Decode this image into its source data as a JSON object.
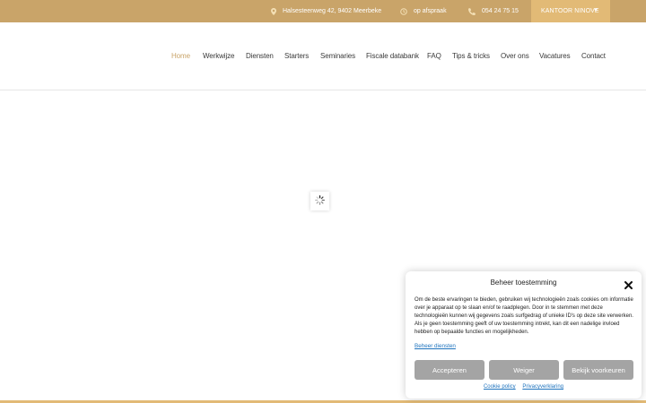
{
  "topbar": {
    "address": "Halsesteenweg 42, 9402 Meerbeke",
    "appointment": "op afspraak",
    "phone": "054 24 75 15",
    "office_selector": "KANTOOR NINOVE"
  },
  "nav": {
    "items": [
      "Home",
      "Werkwijze",
      "Diensten",
      "Starters",
      "Seminaries",
      "Fiscale databank",
      "FAQ",
      "Tips & tricks",
      "Over ons",
      "Vacatures",
      "Contact"
    ],
    "active": "Home"
  },
  "cookie": {
    "title": "Beheer toestemming",
    "body": "Om de beste ervaringen te bieden, gebruiken wij technologieën zoals cookies om informatie over je apparaat op te slaan en/of te raadplegen. Door in te stemmen met deze technologieën kunnen wij gegevens zoals surfgedrag of unieke ID's op deze site verwerken. Als je geen toestemming geeft of uw toestemming intrekt, kan dit een nadelige invloed hebben op bepaalde functies en mogelijkheden.",
    "manage_link": "Beheer diensten",
    "accept": "Accepteren",
    "deny": "Weiger",
    "preferences": "Bekijk voorkeuren",
    "cookie_policy": "Cookie policy",
    "privacy": "Privacyverklaring"
  },
  "colors": {
    "brand_gold": "#c9a469",
    "office_button": "#e2ba76",
    "cookie_button": "#a4a4a4",
    "link_blue": "#1e73be"
  },
  "icons": [
    "map-marker-icon",
    "clock-icon",
    "phone-icon",
    "caret-down-icon",
    "close-icon",
    "loading-spinner-icon"
  ]
}
